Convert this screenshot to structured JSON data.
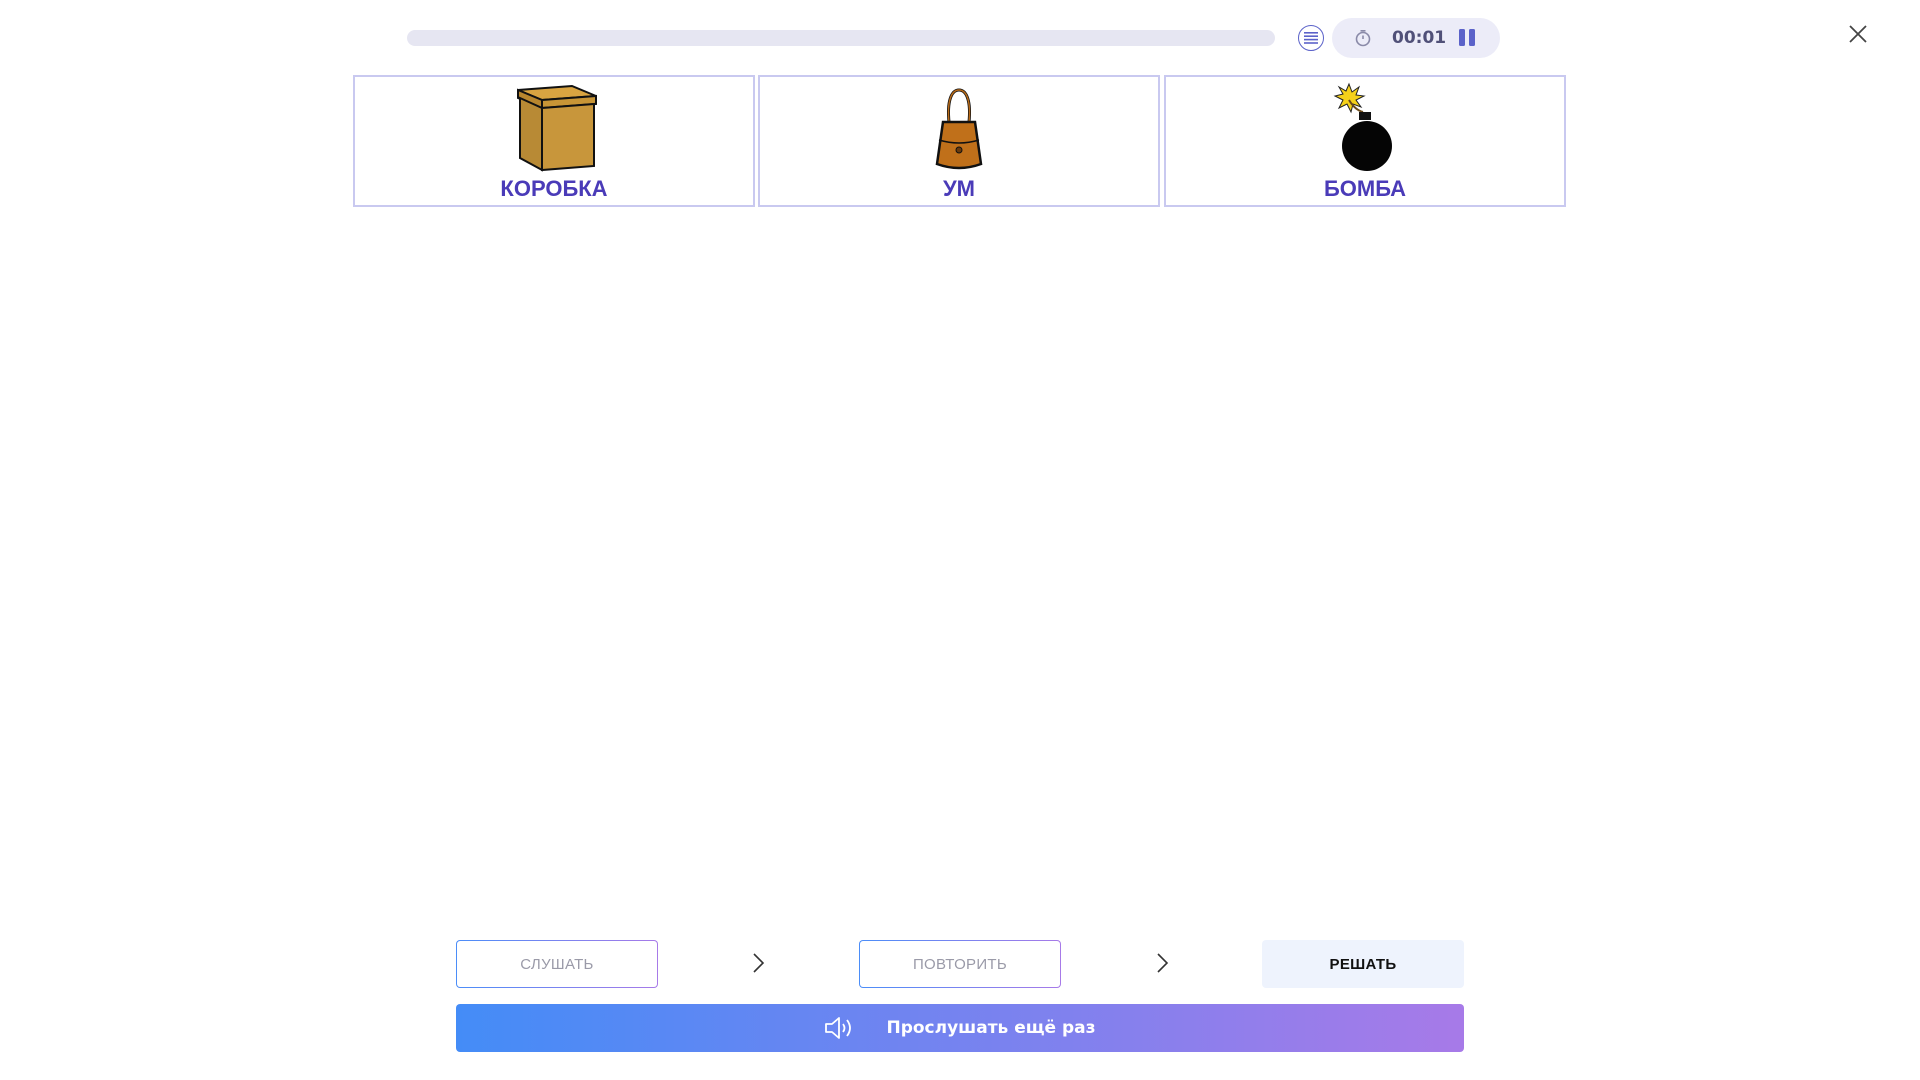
{
  "header": {
    "progress": 0,
    "timer": "00:01"
  },
  "cards": [
    {
      "label": "КОРОБКА",
      "icon": "box-icon"
    },
    {
      "label": "УМ",
      "icon": "bag-icon"
    },
    {
      "label": "БОМБА",
      "icon": "bomb-icon"
    }
  ],
  "steps": {
    "listen": "СЛУШАТЬ",
    "repeat": "ПОВТОРИТЬ",
    "solve": "РЕШАТЬ"
  },
  "listen_again": "Прослушать ещё раз",
  "colors": {
    "accent": "#5b62c9",
    "card_label": "#4a3bb8",
    "card_border": "#c9c9f0",
    "gradient_start": "#448cf7",
    "gradient_end": "#a77ae8"
  }
}
